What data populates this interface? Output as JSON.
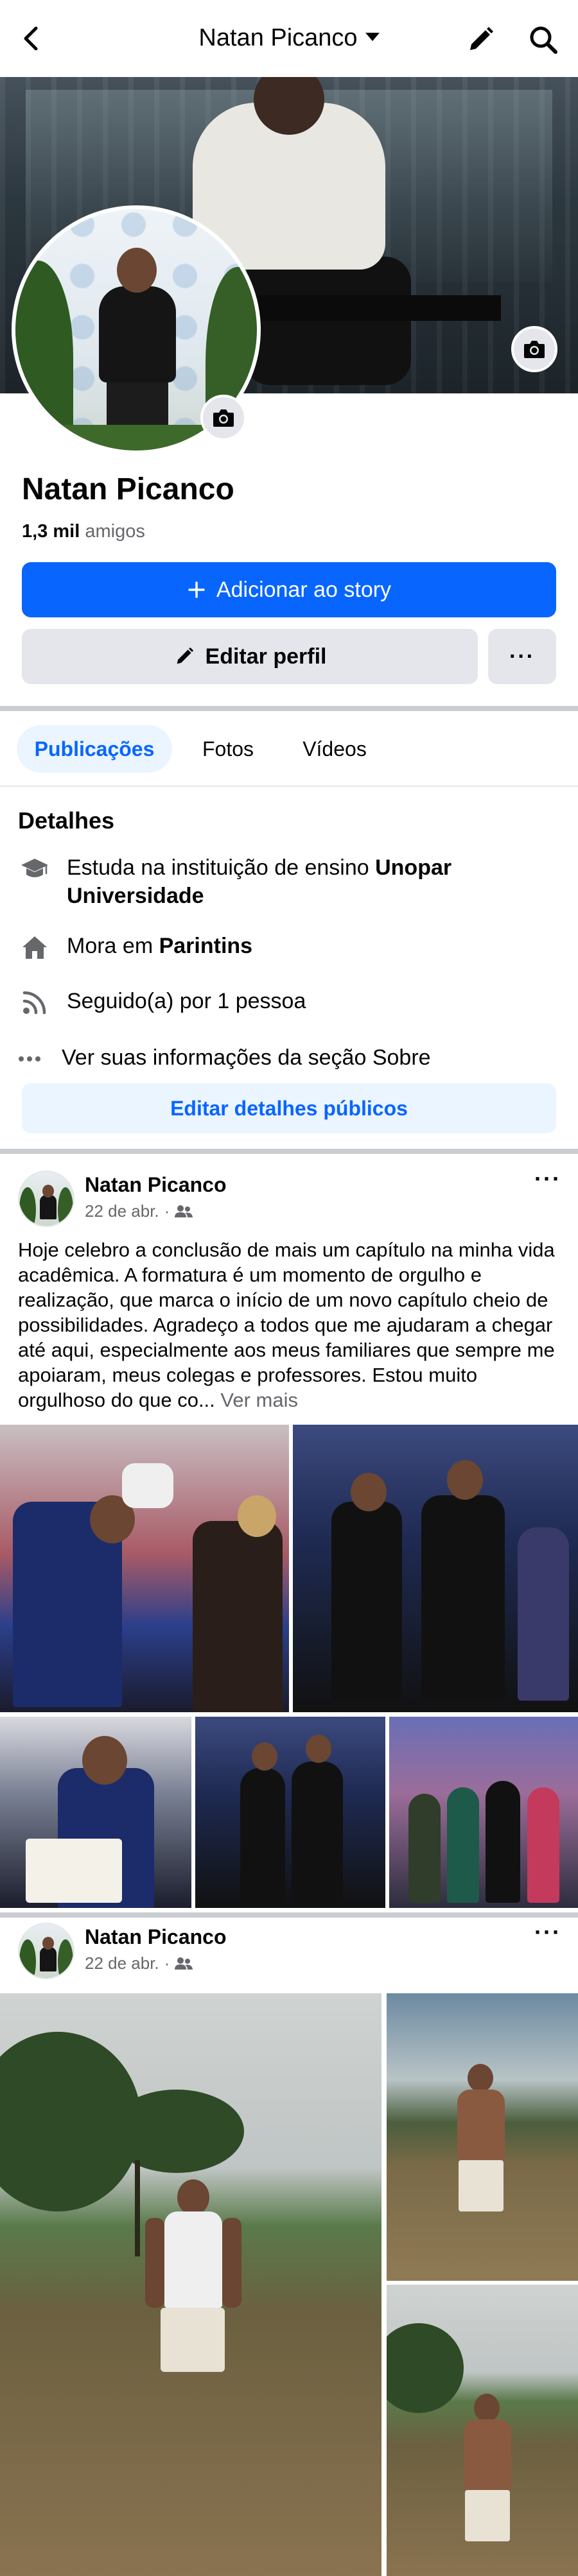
{
  "header": {
    "title": "Natan Picanco"
  },
  "profile": {
    "name": "Natan Picanco",
    "friends_count": "1,3 mil",
    "friends_label": "amigos"
  },
  "actions": {
    "add_story": "Adicionar ao story",
    "edit_profile": "Editar perfil",
    "more": "···"
  },
  "tabs": [
    {
      "label": "Publicações",
      "active": true
    },
    {
      "label": "Fotos",
      "active": false
    },
    {
      "label": "Vídeos",
      "active": false
    }
  ],
  "details": {
    "title": "Detalhes",
    "study_prefix": "Estuda na instituição de ensino ",
    "study_place": "Unopar Universidade",
    "lives_prefix": "Mora em ",
    "lives_place": "Parintins",
    "followers": "Seguido(a) por 1 pessoa",
    "about": "Ver suas informações da seção Sobre",
    "edit_button": "Editar detalhes públicos"
  },
  "posts": [
    {
      "author": "Natan Picanco",
      "date": "22 de abr.",
      "audience_icon": "friends-icon",
      "text": "Hoje celebro a conclusão de mais um capítulo na minha vida acadêmica. A formatura é um momento de orgulho e realização, que marca o início de um novo capítulo cheio de possibilidades. Agradeço a todos que me ajudaram a chegar até aqui, especialmente aos meus familiares que sempre me apoiaram, meus colegas e professores. Estou muito orgulhoso do que co...",
      "see_more": "Ver mais",
      "photo_count": 5
    },
    {
      "author": "Natan Picanco",
      "date": "22 de abr.",
      "audience_icon": "friends-icon",
      "photo_count": 3
    }
  ],
  "colors": {
    "primary": "#0866ff",
    "secondary_bg": "#e4e6eb",
    "light_blue_bg": "#ebf5ff",
    "muted_text": "#65676b"
  }
}
